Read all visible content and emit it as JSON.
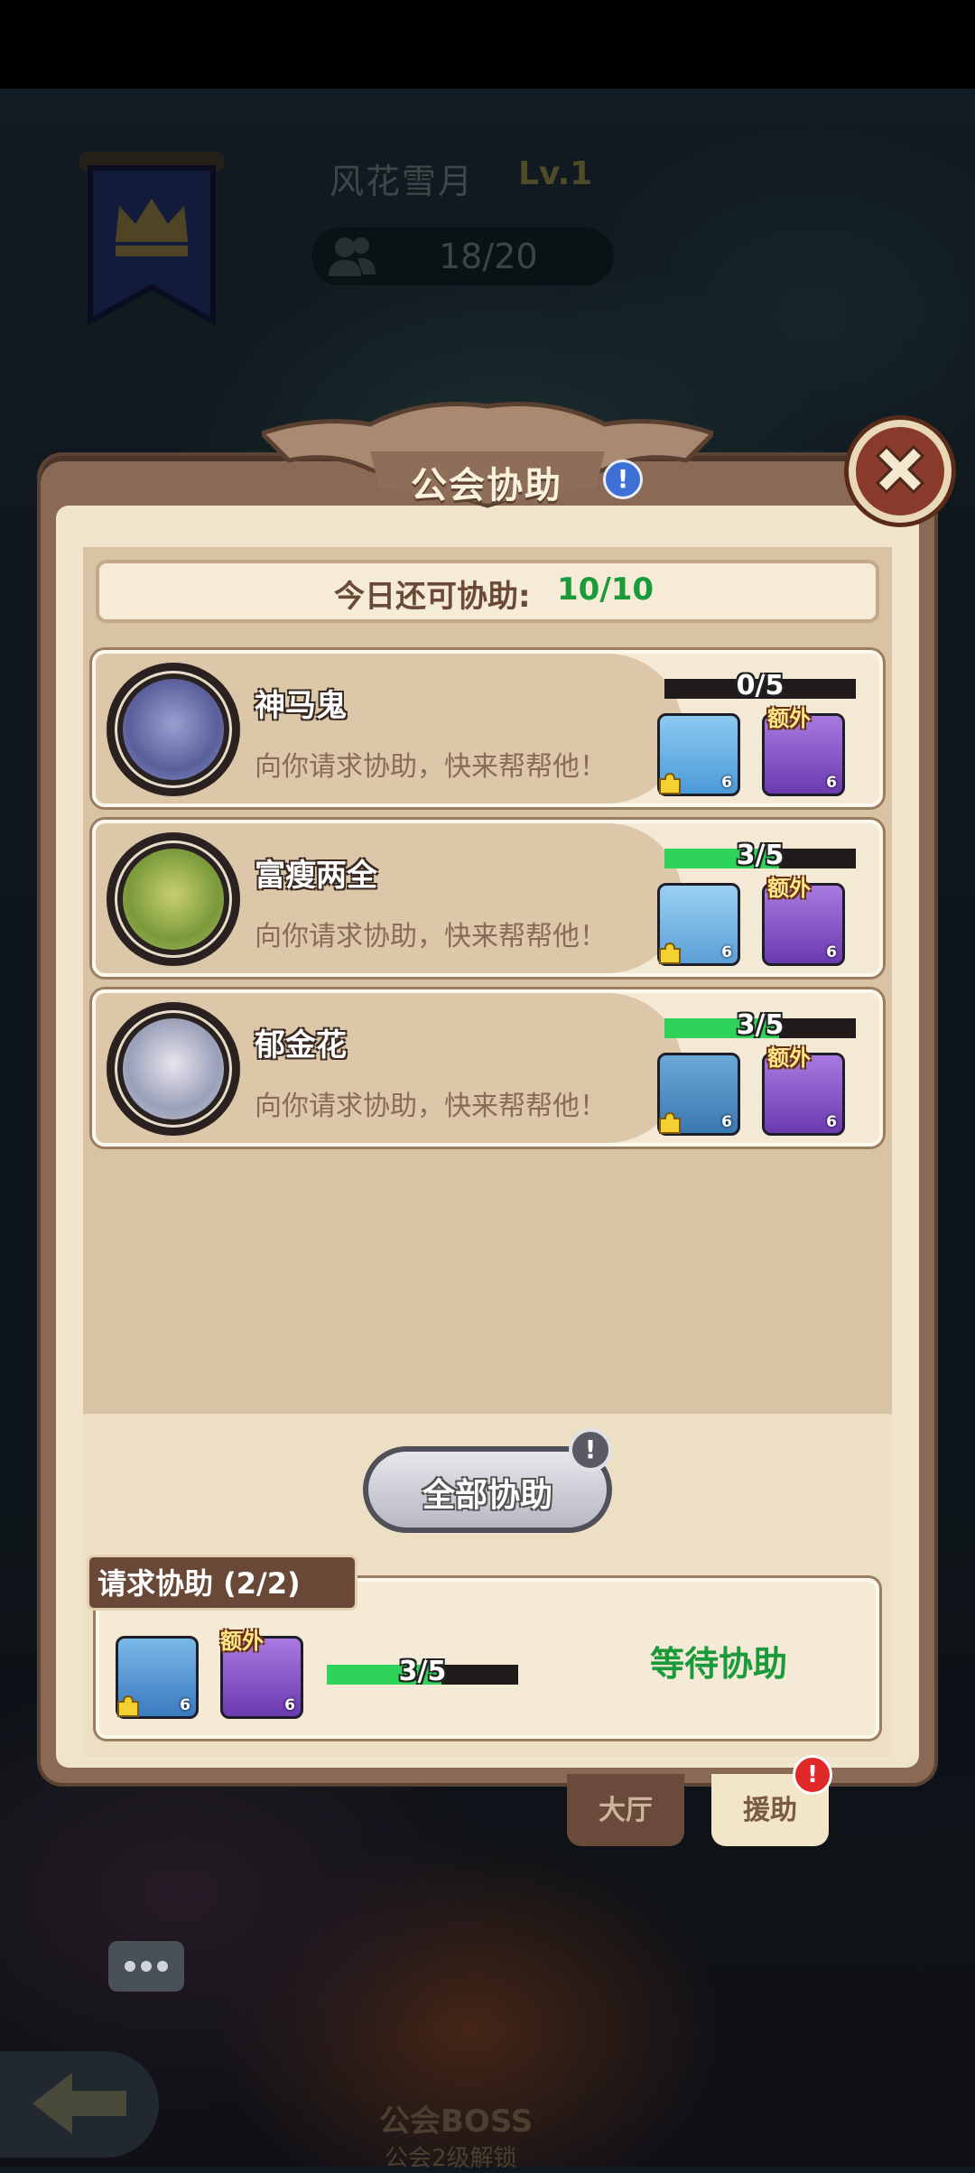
{
  "guild": {
    "name": "风花雪月",
    "level": "Lv.1",
    "members": "18/20"
  },
  "dialog": {
    "title": "公会协助",
    "remaining_label": "今日还可协助:",
    "remaining_value": "10/10"
  },
  "requests": [
    {
      "name": "神马鬼",
      "message": "向你请求协助，快来帮帮他！",
      "progress_text": "0/5",
      "progress": 0.0,
      "extra_label": "额外",
      "card_count_a": "6",
      "card_count_b": "6"
    },
    {
      "name": "富瘦两全",
      "message": "向你请求协助，快来帮帮他！",
      "progress_text": "3/5",
      "progress": 0.6,
      "extra_label": "额外",
      "card_count_a": "6",
      "card_count_b": "6"
    },
    {
      "name": "郁金花",
      "message": "向你请求协助，快来帮帮他！",
      "progress_text": "3/5",
      "progress": 0.6,
      "extra_label": "额外",
      "card_count_a": "6",
      "card_count_b": "6"
    }
  ],
  "assist_all": {
    "label": "全部协助",
    "badge": "!"
  },
  "my_request": {
    "title": "请求协助 (2/2)",
    "extra_label": "额外",
    "card_count_a": "6",
    "card_count_b": "6",
    "progress_text": "3/5",
    "progress": 0.6,
    "status": "等待协助"
  },
  "tabs": {
    "hall": "大厅",
    "assist": "援助",
    "assist_badge": "!"
  },
  "footer": {
    "boss_label": "公会BOSS",
    "boss_unlock": "公会2级解锁"
  },
  "colors": {
    "accent_green": "#1a9a3a",
    "progress_green": "#2ed45a",
    "panel_brown": "#8a6a55",
    "parchment": "#f0e4cc"
  }
}
